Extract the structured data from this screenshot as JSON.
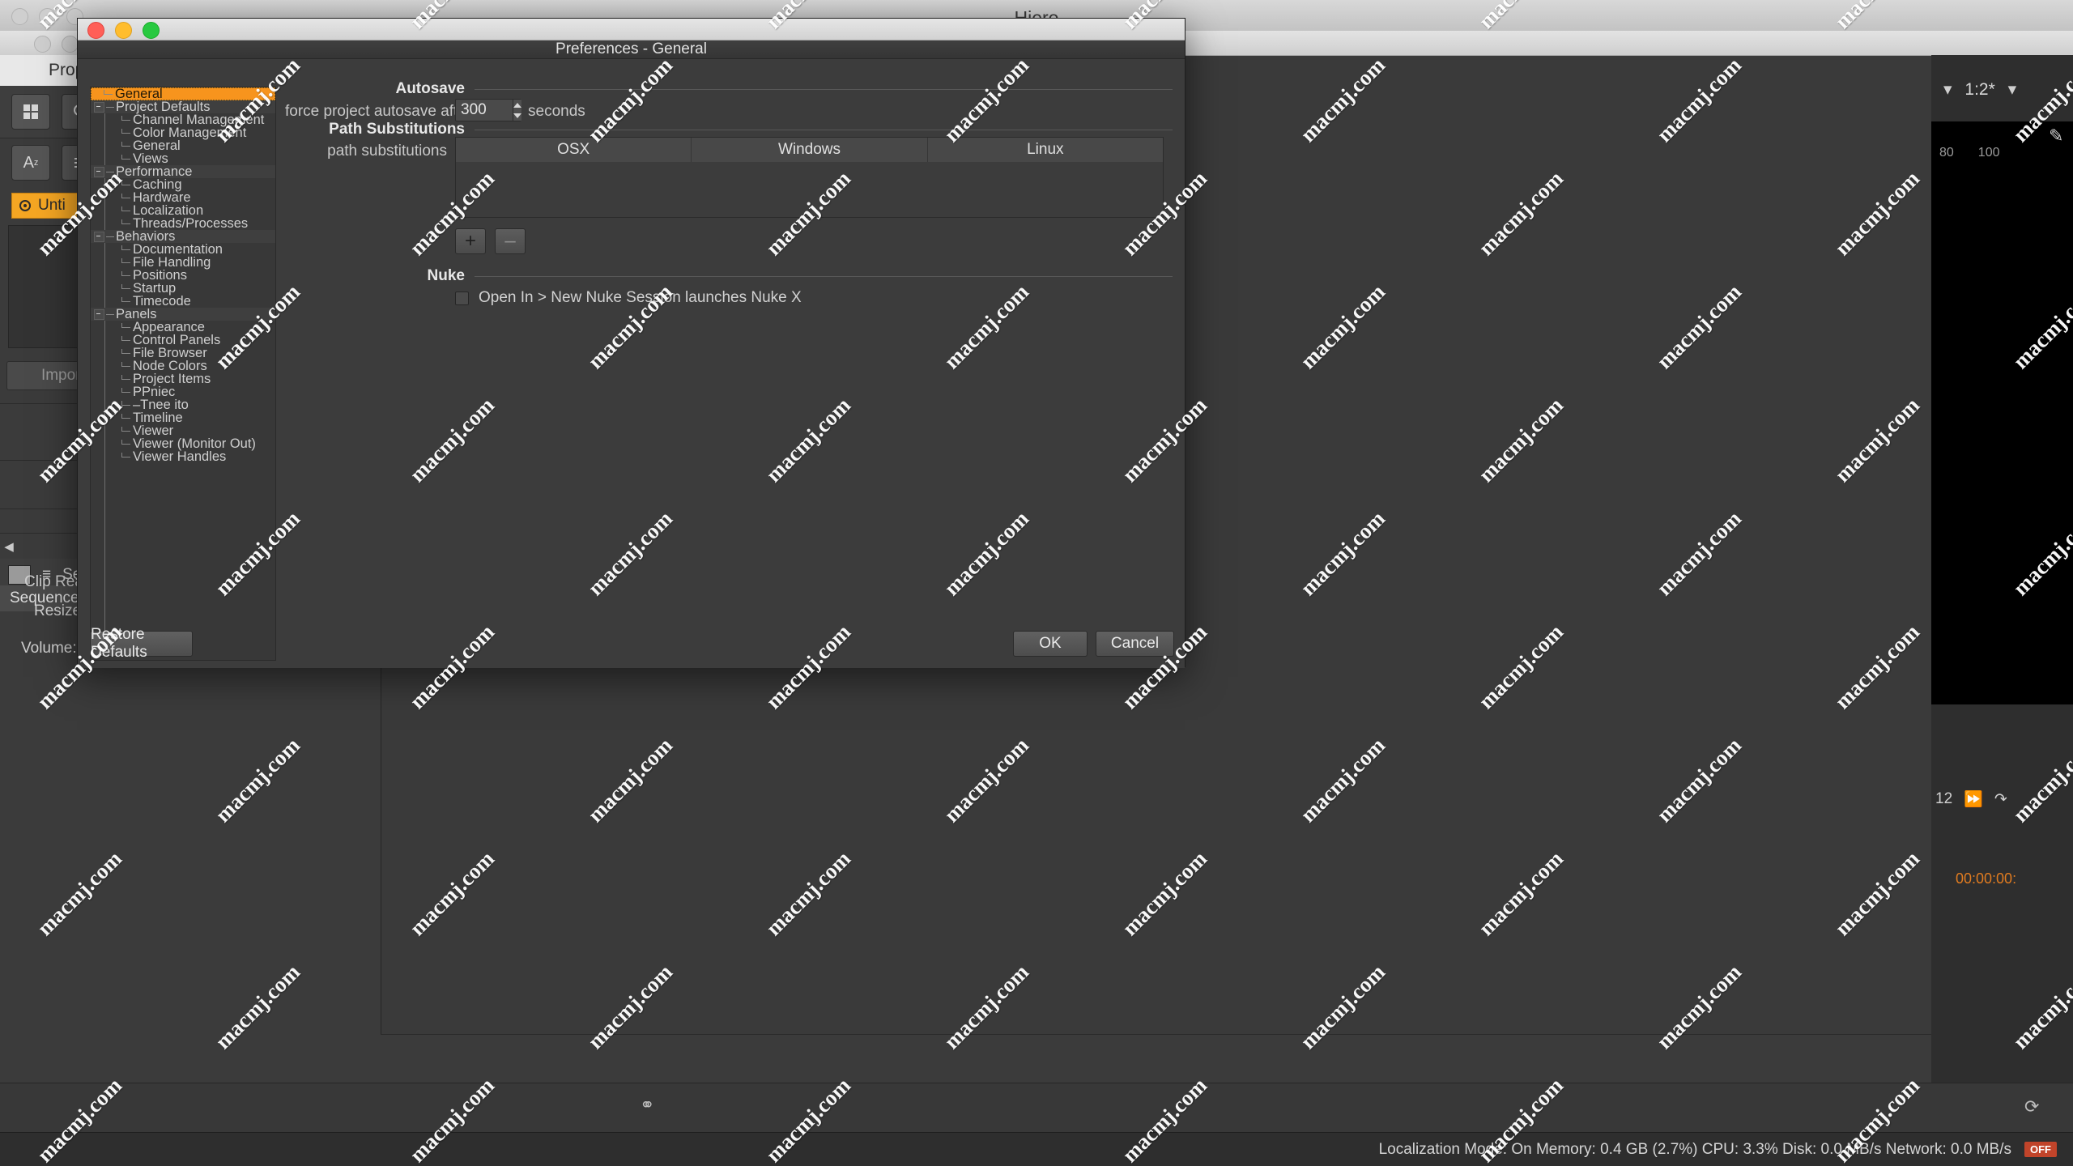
{
  "host_app": {
    "title": "Hiero",
    "properties_panel_title": "Properties",
    "bin_item_label": "Unti",
    "import_button_label": "Import Trac",
    "sequence_tab_label": "Sequence",
    "sequence_bar_label": "Sequ",
    "form_labels": [
      "Clip Rea",
      "Resize T",
      "Volume:"
    ],
    "zoom_level": "1:2*",
    "scale_ticks": [
      "80",
      "100"
    ],
    "frame_number": "12",
    "timecode": "00:00:00:",
    "status_bar": "Localization Mode: On  Memory: 0.4 GB (2.7%) CPU: 3.3% Disk: 0.0 MB/s Network: 0.0 MB/s",
    "status_badge": "OFF"
  },
  "dialog": {
    "title": "Preferences - General",
    "tree": {
      "items": [
        {
          "label": "General",
          "depth": 0,
          "kind": "leaf-root",
          "selected": true
        },
        {
          "label": "Project Defaults",
          "depth": 0,
          "kind": "group",
          "selected": false
        },
        {
          "label": "Channel Management",
          "depth": 1,
          "kind": "child",
          "selected": false
        },
        {
          "label": "Color Management",
          "depth": 1,
          "kind": "child",
          "selected": false
        },
        {
          "label": "General",
          "depth": 1,
          "kind": "child",
          "selected": false
        },
        {
          "label": "Views",
          "depth": 1,
          "kind": "child-last",
          "selected": false
        },
        {
          "label": "Performance",
          "depth": 0,
          "kind": "group",
          "selected": false
        },
        {
          "label": "Caching",
          "depth": 1,
          "kind": "child",
          "selected": false
        },
        {
          "label": "Hardware",
          "depth": 1,
          "kind": "child",
          "selected": false
        },
        {
          "label": "Localization",
          "depth": 1,
          "kind": "child",
          "selected": false
        },
        {
          "label": "Threads/Processes",
          "depth": 1,
          "kind": "child-last",
          "selected": false
        },
        {
          "label": "Behaviors",
          "depth": 0,
          "kind": "group",
          "selected": false
        },
        {
          "label": "Documentation",
          "depth": 1,
          "kind": "child",
          "selected": false
        },
        {
          "label": "File Handling",
          "depth": 1,
          "kind": "child",
          "selected": false
        },
        {
          "label": "Positions",
          "depth": 1,
          "kind": "child",
          "selected": false
        },
        {
          "label": "Startup",
          "depth": 1,
          "kind": "child",
          "selected": false
        },
        {
          "label": "Timecode",
          "depth": 1,
          "kind": "child-last",
          "selected": false
        },
        {
          "label": "Panels",
          "depth": 0,
          "kind": "group",
          "selected": false
        },
        {
          "label": "Appearance",
          "depth": 1,
          "kind": "child",
          "selected": false
        },
        {
          "label": "Control Panels",
          "depth": 1,
          "kind": "child",
          "selected": false
        },
        {
          "label": "File Browser",
          "depth": 1,
          "kind": "child",
          "selected": false
        },
        {
          "label": "Node Colors",
          "depth": 1,
          "kind": "child",
          "selected": false
        },
        {
          "label": "Project Items",
          "depth": 1,
          "kind": "child",
          "selected": false
        },
        {
          "label": "PPniec",
          "depth": 1,
          "kind": "child",
          "selected": false
        },
        {
          "label": "–Tnee ito",
          "depth": 1,
          "kind": "child",
          "selected": false
        },
        {
          "label": "Timeline",
          "depth": 1,
          "kind": "child",
          "selected": false
        },
        {
          "label": "Viewer",
          "depth": 1,
          "kind": "child",
          "selected": false
        },
        {
          "label": "Viewer (Monitor Out)",
          "depth": 1,
          "kind": "child",
          "selected": false
        },
        {
          "label": "Viewer Handles",
          "depth": 1,
          "kind": "child-last",
          "selected": false
        }
      ]
    },
    "sections": {
      "autosave": {
        "heading": "Autosave",
        "autosave_label": "force project autosave after",
        "autosave_value": "300",
        "autosave_unit": "seconds"
      },
      "path_substitutions": {
        "heading": "Path Substitutions",
        "field_label": "path substitutions",
        "columns": [
          "OSX",
          "Windows",
          "Linux"
        ],
        "rows": [],
        "add_button_label": "+",
        "remove_button_label": "–"
      },
      "nuke": {
        "heading": "Nuke",
        "checkbox_label": "Open In > New Nuke Session launches Nuke X",
        "checkbox_checked": false
      }
    },
    "footer": {
      "restore_defaults_label": "Restore Defaults",
      "ok_label": "OK",
      "cancel_label": "Cancel"
    }
  },
  "watermark": {
    "text": "macmj.com"
  },
  "colors": {
    "accent_orange": "#f7941d",
    "dialog_bg": "#3c3c3c",
    "tree_bg": "#383838",
    "status_red": "#c1442a"
  }
}
